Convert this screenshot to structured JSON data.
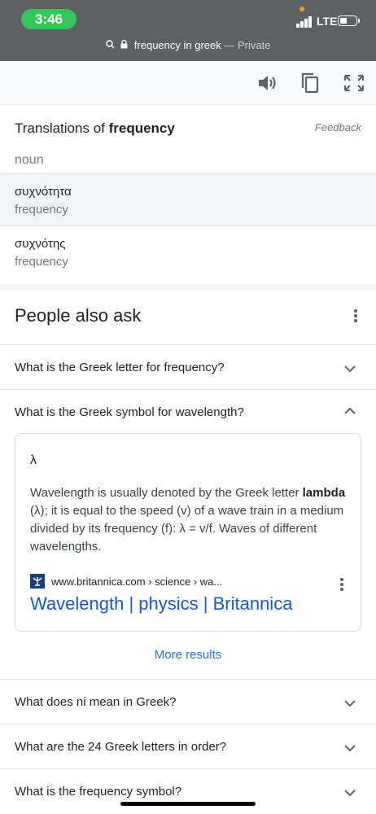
{
  "status": {
    "time": "3:46",
    "network": "LTE"
  },
  "urlbar": {
    "query": "frequency in greek",
    "mode": "— Private"
  },
  "translations": {
    "title_prefix": "Translations of ",
    "title_word": "frequency",
    "feedback": "Feedback",
    "part_of_speech": "noun",
    "items": [
      {
        "word": "συχνότητα",
        "meaning": "frequency"
      },
      {
        "word": "συχνότης",
        "meaning": "frequency"
      }
    ]
  },
  "people_also_ask": {
    "title": "People also ask",
    "questions": [
      {
        "text": "What is the Greek letter for frequency?",
        "expanded": false
      },
      {
        "text": "What is the Greek symbol for wavelength?",
        "expanded": true
      },
      {
        "text": "What does ni mean in Greek?",
        "expanded": false
      },
      {
        "text": "What are the 24 Greek letters in order?",
        "expanded": false
      },
      {
        "text": "What is the frequency symbol?",
        "expanded": false
      }
    ],
    "answer": {
      "symbol": "λ",
      "text_before": "Wavelength is usually denoted by the Greek letter ",
      "text_bold": "lambda",
      "text_after": " (λ); it is equal to the speed (v) of a wave train in a medium divided by its frequency (f): λ = v/f. Waves of different wavelengths.",
      "source_url": "www.britannica.com › science › wa...",
      "source_title": "Wavelength | physics | Britannica"
    },
    "more_results": "More results"
  },
  "colors": {
    "accent": "#1a73e8",
    "link": "#1558d6",
    "status_pill": "#34c759"
  }
}
